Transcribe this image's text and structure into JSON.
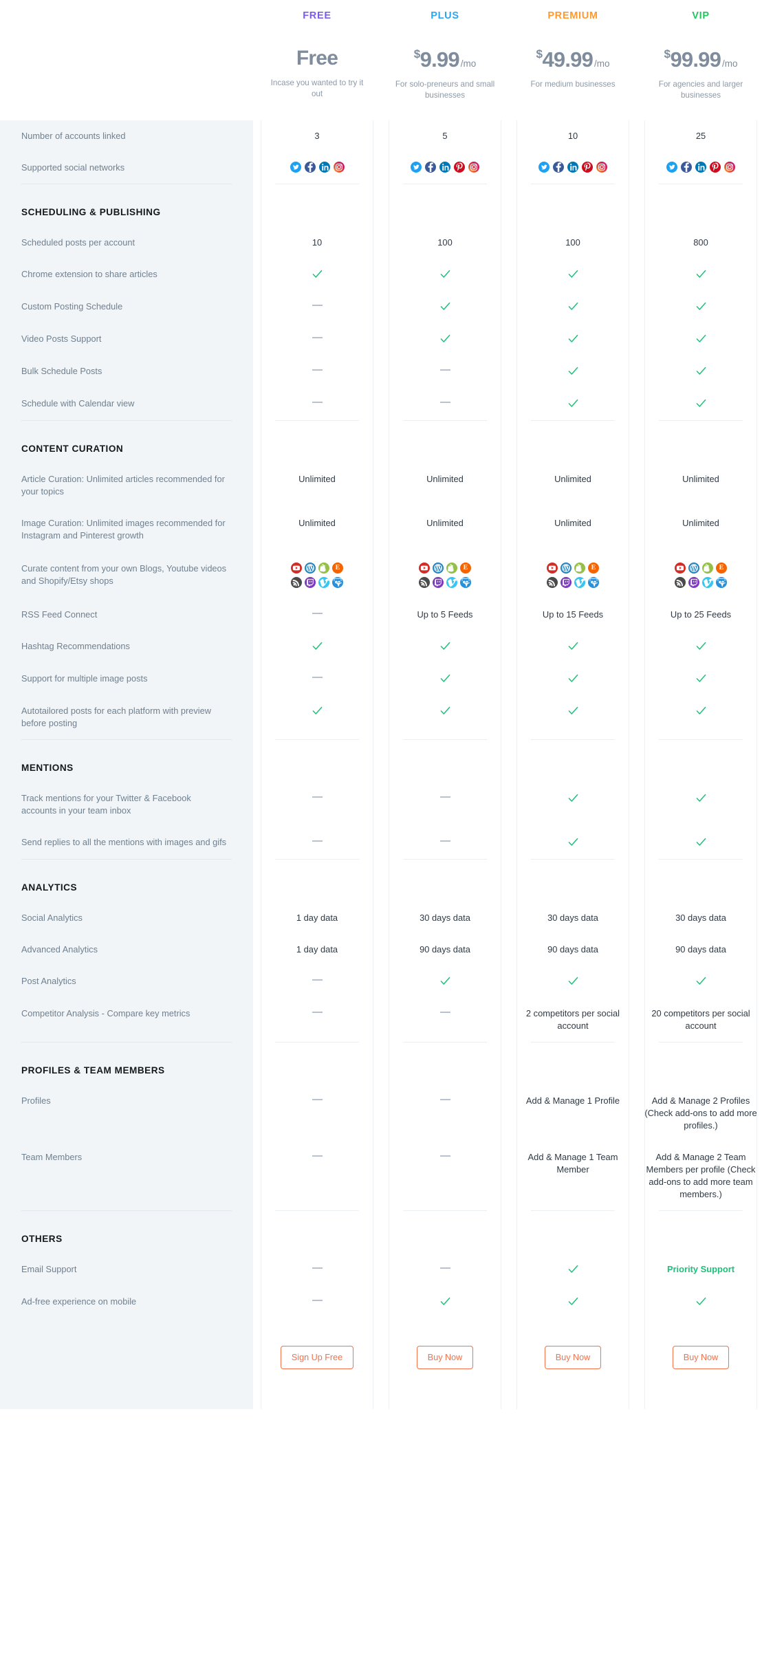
{
  "plans": [
    {
      "name": "FREE",
      "color": "#7b5cf0",
      "currency": "",
      "amount": "Free",
      "per": "",
      "desc": "Incase you wanted to try it out",
      "cta": "Sign Up Free"
    },
    {
      "name": "PLUS",
      "color": "#2ba6f5",
      "currency": "$",
      "amount": "9.99",
      "per": "/mo",
      "desc": "For solo-preneurs and small businesses",
      "cta": "Buy Now"
    },
    {
      "name": "PREMIUM",
      "color": "#ff9a2e",
      "currency": "$",
      "amount": "49.99",
      "per": "/mo",
      "desc": "For medium businesses",
      "cta": "Buy Now"
    },
    {
      "name": "VIP",
      "color": "#22c55e",
      "currency": "$",
      "amount": "99.99",
      "per": "/mo",
      "desc": "For agencies and larger businesses",
      "cta": "Buy Now"
    }
  ],
  "icon_colors": {
    "twitter": "#1da1f2",
    "facebook": "#3b5998",
    "linkedin": "#0077b5",
    "pinterest": "#cc0d1f",
    "instagram": "#d6249f",
    "youtube": "#d22c26",
    "wordpress": "#2381bb",
    "shopify": "#95bf47",
    "etsy": "#f56400",
    "rss": "#4a4a4a",
    "twitch": "#7d3bbd",
    "vimeo": "#35c6f4",
    "slideshare": "#2a90d8"
  },
  "check_color": "#1ec07a",
  "dash_color": "#b9c2cb",
  "accent_button": "#f4714a",
  "sections": [
    {
      "heading": null,
      "rows": [
        {
          "label": "Number of accounts linked",
          "values": [
            "3",
            "5",
            "10",
            "25"
          ],
          "type": "text"
        },
        {
          "label": "Supported social networks",
          "type": "social",
          "values": [
            [
              "twitter",
              "facebook",
              "linkedin",
              "instagram"
            ],
            [
              "twitter",
              "facebook",
              "linkedin",
              "pinterest",
              "instagram"
            ],
            [
              "twitter",
              "facebook",
              "linkedin",
              "pinterest",
              "instagram"
            ],
            [
              "twitter",
              "facebook",
              "linkedin",
              "pinterest",
              "instagram"
            ]
          ]
        }
      ]
    },
    {
      "heading": "SCHEDULING & PUBLISHING",
      "rows": [
        {
          "label": "Scheduled posts per account",
          "values": [
            "10",
            "100",
            "100",
            "800"
          ],
          "type": "text"
        },
        {
          "label": "Chrome extension to share articles",
          "values": [
            "check",
            "check",
            "check",
            "check"
          ],
          "type": "mark"
        },
        {
          "label": "Custom Posting Schedule",
          "values": [
            "dash",
            "check",
            "check",
            "check"
          ],
          "type": "mark"
        },
        {
          "label": "Video Posts Support",
          "values": [
            "dash",
            "check",
            "check",
            "check"
          ],
          "type": "mark"
        },
        {
          "label": "Bulk Schedule Posts",
          "values": [
            "dash",
            "dash",
            "check",
            "check"
          ],
          "type": "mark"
        },
        {
          "label": "Schedule with Calendar view",
          "values": [
            "dash",
            "dash",
            "check",
            "check"
          ],
          "type": "mark"
        }
      ]
    },
    {
      "heading": "CONTENT CURATION",
      "rows": [
        {
          "label": "Article Curation: Unlimited articles recommended for your topics",
          "values": [
            "Unlimited",
            "Unlimited",
            "Unlimited",
            "Unlimited"
          ],
          "type": "text"
        },
        {
          "label": "Image Curation: Unlimited images recommended for Instagram and Pinterest growth",
          "values": [
            "Unlimited",
            "Unlimited",
            "Unlimited",
            "Unlimited"
          ],
          "type": "text"
        },
        {
          "label": "Curate content from your own Blogs, Youtube videos and Shopify/Etsy shops",
          "type": "curation",
          "values": [
            [
              "youtube",
              "wordpress",
              "shopify",
              "etsy",
              "rss",
              "twitch",
              "vimeo",
              "slideshare"
            ],
            [
              "youtube",
              "wordpress",
              "shopify",
              "etsy",
              "rss",
              "twitch",
              "vimeo",
              "slideshare"
            ],
            [
              "youtube",
              "wordpress",
              "shopify",
              "etsy",
              "rss",
              "twitch",
              "vimeo",
              "slideshare"
            ],
            [
              "youtube",
              "wordpress",
              "shopify",
              "etsy",
              "rss",
              "twitch",
              "vimeo",
              "slideshare"
            ]
          ]
        },
        {
          "label": "RSS Feed Connect",
          "values": [
            "dash",
            "Up to 5 Feeds",
            "Up to 15 Feeds",
            "Up to 25 Feeds"
          ],
          "type": "text"
        },
        {
          "label": "Hashtag Recommendations",
          "values": [
            "check",
            "check",
            "check",
            "check"
          ],
          "type": "mark"
        },
        {
          "label": "Support for multiple image posts",
          "values": [
            "dash",
            "check",
            "check",
            "check"
          ],
          "type": "mark"
        },
        {
          "label": "Autotailored posts for each platform with preview before posting",
          "values": [
            "check",
            "check",
            "check",
            "check"
          ],
          "type": "mark"
        }
      ]
    },
    {
      "heading": "MENTIONS",
      "rows": [
        {
          "label": "Track mentions for your Twitter & Facebook accounts in your team inbox",
          "values": [
            "dash",
            "dash",
            "check",
            "check"
          ],
          "type": "mark"
        },
        {
          "label": "Send replies to all the mentions with images and gifs",
          "values": [
            "dash",
            "dash",
            "check",
            "check"
          ],
          "type": "mark"
        }
      ]
    },
    {
      "heading": "ANALYTICS",
      "rows": [
        {
          "label": "Social Analytics",
          "values": [
            "1 day data",
            "30 days data",
            "30 days data",
            "30 days data"
          ],
          "type": "text"
        },
        {
          "label": "Advanced Analytics",
          "values": [
            "1 day data",
            "90 days data",
            "90 days data",
            "90 days data"
          ],
          "type": "text"
        },
        {
          "label": "Post Analytics",
          "values": [
            "dash",
            "check",
            "check",
            "check"
          ],
          "type": "mark"
        },
        {
          "label": "Competitor Analysis - Compare key metrics",
          "values": [
            "dash",
            "dash",
            "2 competitors per social account",
            "20 competitors per social account"
          ],
          "type": "text"
        }
      ]
    },
    {
      "heading": "PROFILES & TEAM MEMBERS",
      "rows": [
        {
          "label": "Profiles",
          "values": [
            "dash",
            "dash",
            "Add & Manage 1 Profile",
            "Add & Manage 2 Profiles (Check add-ons to add more profiles.)"
          ],
          "type": "text"
        },
        {
          "label": "Team Members",
          "values": [
            "dash",
            "dash",
            "Add & Manage 1 Team Member",
            "Add & Manage 2 Team Members per profile (Check add-ons to add more team members.)"
          ],
          "type": "text"
        }
      ]
    },
    {
      "heading": "OTHERS",
      "rows": [
        {
          "label": "Email Support",
          "values": [
            "dash",
            "dash",
            "check",
            "Priority Support"
          ],
          "type": "mark"
        },
        {
          "label": "Ad-free experience on mobile",
          "values": [
            "dash",
            "check",
            "check",
            "check"
          ],
          "type": "mark"
        }
      ]
    }
  ]
}
